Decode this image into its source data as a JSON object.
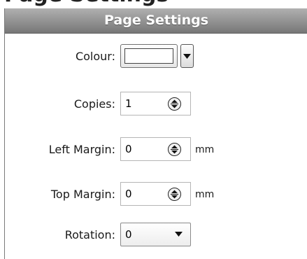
{
  "panel": {
    "title": "Page Settings"
  },
  "fields": {
    "colour": {
      "label": "Colour:",
      "swatch_color": "#ffffff"
    },
    "copies": {
      "label": "Copies:",
      "value": "1"
    },
    "left_margin": {
      "label": "Left Margin:",
      "value": "0",
      "unit": "mm"
    },
    "top_margin": {
      "label": "Top Margin:",
      "value": "0",
      "unit": "mm"
    },
    "rotation": {
      "label": "Rotation:",
      "value": "0"
    }
  },
  "icons": {
    "spinner": "up-down-spinner-icon",
    "dropdown": "chevron-down-icon"
  },
  "colors": {
    "header_gradient_top": "#b0b0b0",
    "header_gradient_bottom": "#777777",
    "header_text": "#ffffff"
  }
}
